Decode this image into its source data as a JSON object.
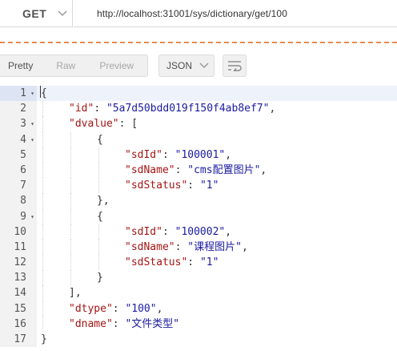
{
  "request": {
    "method": "GET",
    "url": "http://localhost:31001/sys/dictionary/get/100"
  },
  "toolbar": {
    "views": [
      "Pretty",
      "Raw",
      "Preview"
    ],
    "active_view": "Pretty",
    "format": "JSON",
    "wrap_icon": "wrap-lines-icon"
  },
  "code": {
    "lines": [
      {
        "n": "1",
        "fold": true,
        "indent": 0,
        "parts": [
          [
            "p",
            "{"
          ]
        ]
      },
      {
        "n": "2",
        "fold": false,
        "indent": 1,
        "parts": [
          [
            "k",
            "\"id\""
          ],
          [
            "p",
            ": "
          ],
          [
            "s",
            "\"5a7d50bdd019f150f4ab8ef7\""
          ],
          [
            "p",
            ","
          ]
        ]
      },
      {
        "n": "3",
        "fold": true,
        "indent": 1,
        "parts": [
          [
            "k",
            "\"dvalue\""
          ],
          [
            "p",
            ": ["
          ]
        ]
      },
      {
        "n": "4",
        "fold": true,
        "indent": 2,
        "parts": [
          [
            "p",
            "{"
          ]
        ]
      },
      {
        "n": "5",
        "fold": false,
        "indent": 3,
        "parts": [
          [
            "k",
            "\"sdId\""
          ],
          [
            "p",
            ": "
          ],
          [
            "s",
            "\"100001\""
          ],
          [
            "p",
            ","
          ]
        ]
      },
      {
        "n": "6",
        "fold": false,
        "indent": 3,
        "parts": [
          [
            "k",
            "\"sdName\""
          ],
          [
            "p",
            ": "
          ],
          [
            "s",
            "\"cms配置图片\""
          ],
          [
            "p",
            ","
          ]
        ]
      },
      {
        "n": "7",
        "fold": false,
        "indent": 3,
        "parts": [
          [
            "k",
            "\"sdStatus\""
          ],
          [
            "p",
            ": "
          ],
          [
            "s",
            "\"1\""
          ]
        ]
      },
      {
        "n": "8",
        "fold": false,
        "indent": 2,
        "parts": [
          [
            "p",
            "},"
          ]
        ]
      },
      {
        "n": "9",
        "fold": true,
        "indent": 2,
        "parts": [
          [
            "p",
            "{"
          ]
        ]
      },
      {
        "n": "10",
        "fold": false,
        "indent": 3,
        "parts": [
          [
            "k",
            "\"sdId\""
          ],
          [
            "p",
            ": "
          ],
          [
            "s",
            "\"100002\""
          ],
          [
            "p",
            ","
          ]
        ]
      },
      {
        "n": "11",
        "fold": false,
        "indent": 3,
        "parts": [
          [
            "k",
            "\"sdName\""
          ],
          [
            "p",
            ": "
          ],
          [
            "s",
            "\"课程图片\""
          ],
          [
            "p",
            ","
          ]
        ]
      },
      {
        "n": "12",
        "fold": false,
        "indent": 3,
        "parts": [
          [
            "k",
            "\"sdStatus\""
          ],
          [
            "p",
            ": "
          ],
          [
            "s",
            "\"1\""
          ]
        ]
      },
      {
        "n": "13",
        "fold": false,
        "indent": 2,
        "parts": [
          [
            "p",
            "}"
          ]
        ]
      },
      {
        "n": "14",
        "fold": false,
        "indent": 1,
        "parts": [
          [
            "p",
            "],"
          ]
        ]
      },
      {
        "n": "15",
        "fold": false,
        "indent": 1,
        "parts": [
          [
            "k",
            "\"dtype\""
          ],
          [
            "p",
            ": "
          ],
          [
            "s",
            "\"100\""
          ],
          [
            "p",
            ","
          ]
        ]
      },
      {
        "n": "16",
        "fold": false,
        "indent": 1,
        "parts": [
          [
            "k",
            "\"dname\""
          ],
          [
            "p",
            ": "
          ],
          [
            "s",
            "\"文件类型\""
          ]
        ]
      },
      {
        "n": "17",
        "fold": false,
        "indent": 0,
        "parts": [
          [
            "p",
            "}"
          ]
        ]
      }
    ]
  }
}
